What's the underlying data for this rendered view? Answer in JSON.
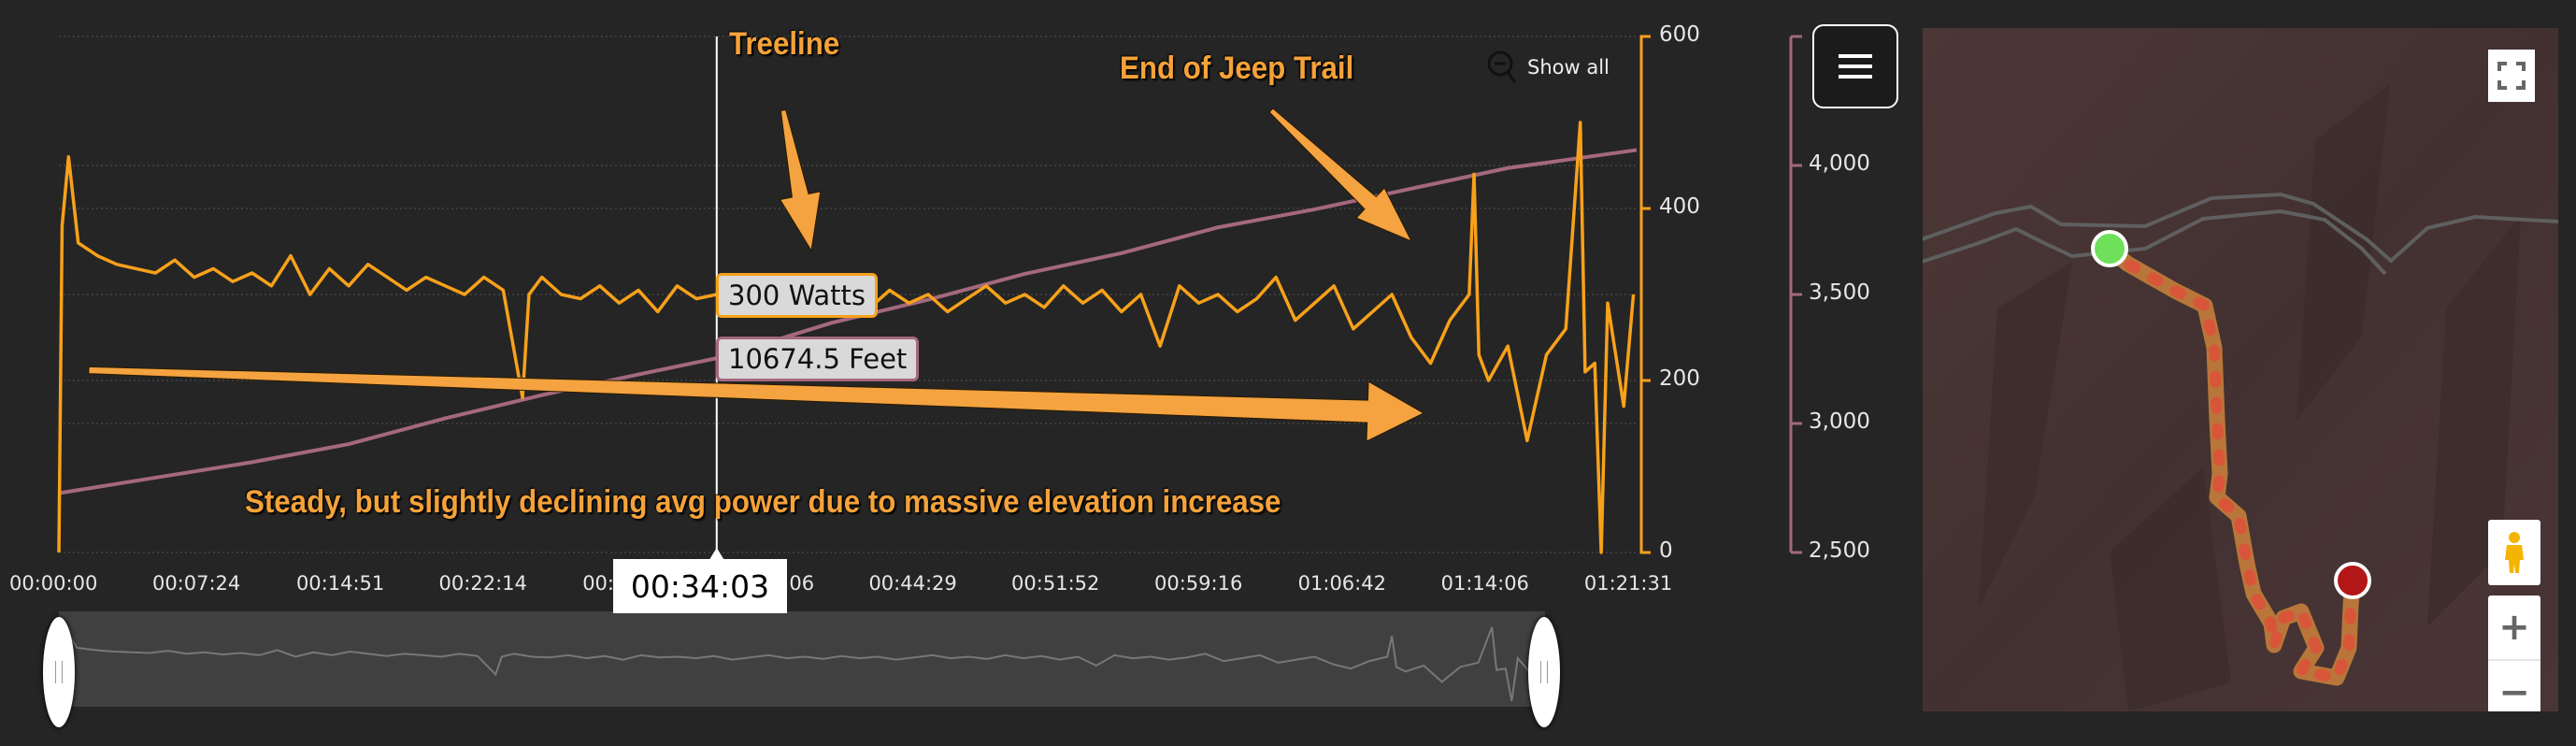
{
  "chart_data": {
    "type": "line",
    "xlabel": "",
    "x_ticks": [
      "00:00:00",
      "00:07:24",
      "00:14:51",
      "00:22:14",
      "00:29:40",
      "00:37:06",
      "00:44:29",
      "00:51:52",
      "00:59:16",
      "01:06:42",
      "01:14:06",
      "01:21:31"
    ],
    "xlim": [
      "00:00:00",
      "01:21:40"
    ],
    "y_axes": [
      {
        "id": "power",
        "unit": "Watts",
        "ylim": [
          0,
          600
        ],
        "ticks": [
          "0",
          "200",
          "400",
          "600"
        ],
        "color": "#f7a11a",
        "side": "right"
      },
      {
        "id": "elevation",
        "unit": "Feet",
        "ylim": [
          2500,
          4500
        ],
        "ticks": [
          "2,500",
          "3,000",
          "3,500",
          "4,000"
        ],
        "color": "#a4687f",
        "side": "right"
      }
    ],
    "grid": true,
    "series": [
      {
        "axis": "power",
        "color": "#f7a11a",
        "time": [
          "00:00:00",
          "00:00:10",
          "00:00:30",
          "00:01:00",
          "00:02:00",
          "00:03:00",
          "00:04:00",
          "00:05:00",
          "00:06:00",
          "00:07:00",
          "00:08:00",
          "00:09:00",
          "00:10:00",
          "00:11:00",
          "00:12:00",
          "00:13:00",
          "00:14:00",
          "00:15:00",
          "00:16:00",
          "00:17:00",
          "00:18:00",
          "00:19:00",
          "00:20:00",
          "00:21:00",
          "00:22:00",
          "00:23:00",
          "00:24:00",
          "00:24:20",
          "00:25:00",
          "00:26:00",
          "00:27:00",
          "00:28:00",
          "00:29:00",
          "00:30:00",
          "00:31:00",
          "00:32:00",
          "00:33:00",
          "00:34:03",
          "00:35:00",
          "00:36:00",
          "00:37:00",
          "00:38:00",
          "00:39:00",
          "00:40:00",
          "00:41:00",
          "00:42:00",
          "00:43:00",
          "00:44:00",
          "00:45:00",
          "00:46:00",
          "00:47:00",
          "00:48:00",
          "00:49:00",
          "00:50:00",
          "00:51:00",
          "00:52:00",
          "00:53:00",
          "00:54:00",
          "00:55:00",
          "00:56:00",
          "00:57:00",
          "00:58:00",
          "00:59:00",
          "01:00:00",
          "01:01:00",
          "01:02:00",
          "01:03:00",
          "01:04:00",
          "01:05:00",
          "01:06:00",
          "01:07:00",
          "01:08:00",
          "01:09:00",
          "01:10:00",
          "01:11:00",
          "01:12:00",
          "01:13:00",
          "01:13:15",
          "01:13:30",
          "01:14:00",
          "01:15:00",
          "01:16:00",
          "01:17:00",
          "01:18:00",
          "01:18:45",
          "01:19:00",
          "01:19:30",
          "01:19:50",
          "01:20:10",
          "01:21:00",
          "01:21:30"
        ],
        "values": [
          0,
          380,
          460,
          360,
          345,
          335,
          330,
          325,
          340,
          320,
          330,
          315,
          325,
          310,
          345,
          300,
          330,
          310,
          335,
          320,
          305,
          320,
          310,
          300,
          320,
          305,
          180,
          300,
          320,
          300,
          295,
          310,
          290,
          305,
          280,
          310,
          295,
          300,
          290,
          305,
          280,
          295,
          310,
          290,
          300,
          285,
          305,
          290,
          300,
          280,
          295,
          310,
          290,
          300,
          285,
          310,
          290,
          305,
          280,
          300,
          240,
          310,
          290,
          300,
          280,
          295,
          320,
          270,
          290,
          310,
          260,
          280,
          300,
          250,
          220,
          270,
          300,
          440,
          230,
          200,
          240,
          130,
          230,
          260,
          500,
          210,
          220,
          0,
          290,
          170,
          300
        ]
      },
      {
        "axis": "elevation",
        "color": "#a4687f",
        "time": [
          "00:00:00",
          "00:05:00",
          "00:10:00",
          "00:15:00",
          "00:20:00",
          "00:25:00",
          "00:30:00",
          "00:34:03",
          "00:40:00",
          "00:45:00",
          "00:50:00",
          "00:55:00",
          "01:00:00",
          "01:05:00",
          "01:10:00",
          "01:15:00",
          "01:21:40"
        ],
        "values": [
          2730,
          2790,
          2850,
          2920,
          3020,
          3110,
          3190,
          3253,
          3390,
          3480,
          3580,
          3660,
          3760,
          3830,
          3910,
          3990,
          4060
        ]
      }
    ],
    "annotations": [
      "Treeline",
      "End of Jeep Trail",
      "Steady, but slightly declining avg power due to massive elevation increase"
    ],
    "crosshair": {
      "time": "00:34:03",
      "power_label": "300 Watts",
      "elevation_label": "10674.5 Feet"
    }
  },
  "controls": {
    "show_all": "Show all"
  },
  "map": {
    "start_marker_color": "#6ee05a",
    "end_marker_color": "#b31616",
    "track_colors": [
      "#d9553a",
      "#b8763a",
      "#7aa83a"
    ]
  }
}
